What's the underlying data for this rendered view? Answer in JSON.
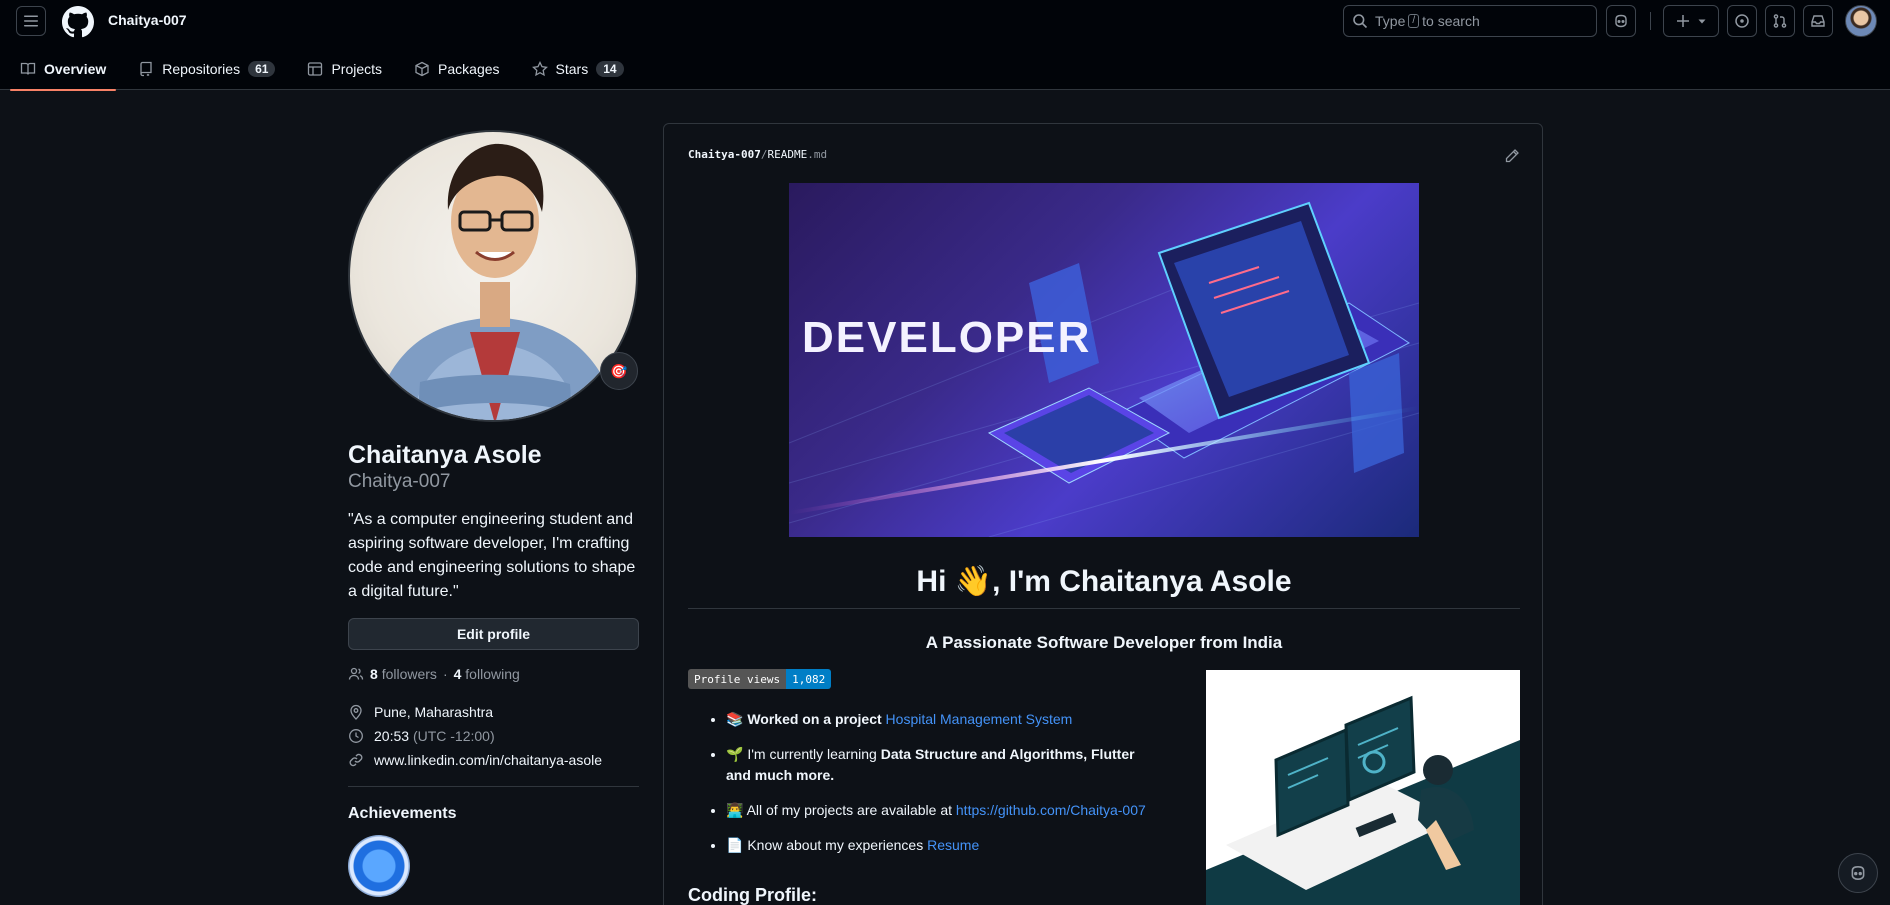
{
  "header": {
    "username": "Chaitya-007",
    "search": {
      "prefix": "Type",
      "key": "/",
      "suffix": "to search"
    }
  },
  "tabs": [
    {
      "label": "Overview",
      "icon": "book-icon",
      "active": true
    },
    {
      "label": "Repositories",
      "icon": "repo-icon",
      "count": "61"
    },
    {
      "label": "Projects",
      "icon": "table-icon"
    },
    {
      "label": "Packages",
      "icon": "package-icon"
    },
    {
      "label": "Stars",
      "icon": "star-icon",
      "count": "14"
    }
  ],
  "profile": {
    "name": "Chaitanya Asole",
    "login": "Chaitya-007",
    "bio": "\"As a computer engineering student and aspiring software developer, I'm crafting code and engineering solutions to shape a digital future.\"",
    "edit_label": "Edit profile",
    "followers_count": "8",
    "followers_label": "followers",
    "separator": "·",
    "following_count": "4",
    "following_label": "following",
    "location": "Pune, Maharashtra",
    "local_time": "20:53",
    "timezone": "(UTC -12:00)",
    "website": "www.linkedin.com/in/chaitanya-asole",
    "achievements_title": "Achievements",
    "status_emoji": "🎯"
  },
  "readme": {
    "path_user": "Chaitya-007",
    "path_sep": "/",
    "path_file": "README",
    "path_ext": ".md",
    "banner_text": "DEVELOPER",
    "greeting": "Hi 👋, I'm Chaitanya Asole",
    "tagline": "A Passionate Software Developer from India",
    "views_label": "Profile views",
    "views_count": "1,082",
    "items": [
      {
        "emoji": "📚",
        "bold_prefix": "Worked on a project",
        "link": "Hospital Management System"
      },
      {
        "emoji": "🌱",
        "text": "I'm currently learning",
        "bold": "Data Structure and Algorithms, Flutter and much more."
      },
      {
        "emoji": "👨‍💻",
        "text": "All of my projects are available at",
        "link": "https://github.com/Chaitya-007"
      },
      {
        "emoji": "📄",
        "text": "Know about my experiences",
        "link": "Resume"
      }
    ],
    "section_title": "Coding Profile:"
  },
  "colors": {
    "background": "#0d1117",
    "header_bg": "#010409",
    "border": "#30363d",
    "accent_underline": "#f78166",
    "link": "#4493f8"
  }
}
